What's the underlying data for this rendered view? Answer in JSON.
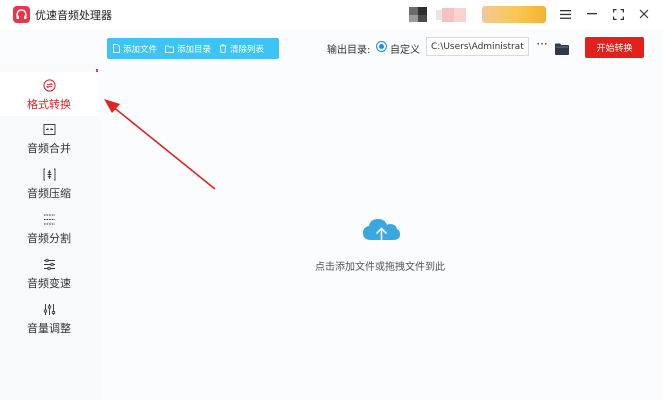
{
  "app": {
    "title": "优速音频处理器",
    "accent_color": "#e8364a",
    "toolbar_color": "#3dc4f3",
    "start_color": "#e2211c"
  },
  "window_controls": {
    "menu_icon": "hamburger-icon",
    "minimize_icon": "minimize-icon",
    "fullscreen_icon": "fullscreen-icon",
    "close_icon": "close-icon"
  },
  "sidebar": {
    "items": [
      {
        "label": "格式转换",
        "icon": "convert-icon",
        "active": true
      },
      {
        "label": "音频合并",
        "icon": "merge-icon",
        "active": false
      },
      {
        "label": "音频压缩",
        "icon": "compress-icon",
        "active": false
      },
      {
        "label": "音频分割",
        "icon": "split-icon",
        "active": false
      },
      {
        "label": "音频变速",
        "icon": "speed-icon",
        "active": false
      },
      {
        "label": "音量调整",
        "icon": "volume-icon",
        "active": false
      }
    ]
  },
  "toolbar": {
    "add_file": "添加文件",
    "add_dir": "添加目录",
    "clear_list": "清除列表",
    "output_label": "输出目录:",
    "custom_option": "自定义",
    "output_path": "C:\\Users\\Administrator\\",
    "more": "···",
    "start": "开始转换"
  },
  "main": {
    "drop_hint": "点击添加文件或拖拽文件到此"
  }
}
